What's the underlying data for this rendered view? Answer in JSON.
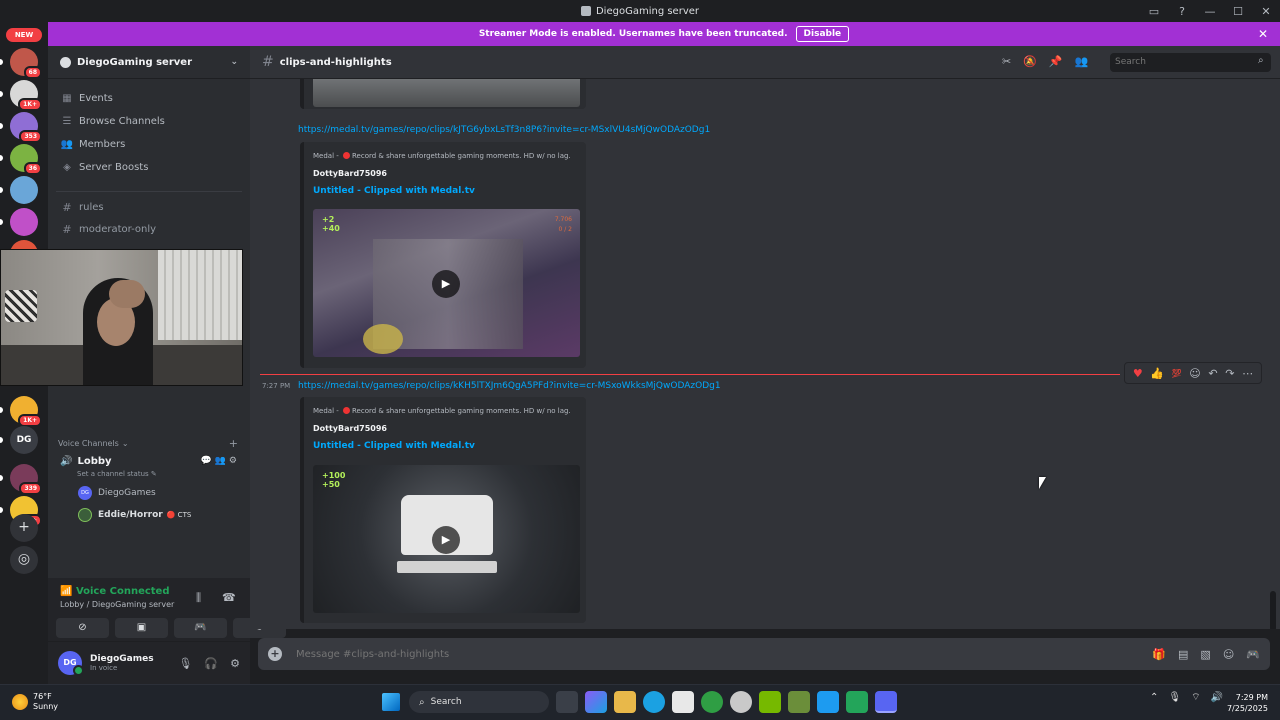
{
  "window": {
    "title": "DiegoGaming server",
    "controls": [
      "▭",
      "?",
      "—",
      "☐",
      "✕"
    ]
  },
  "guilds": {
    "new_label": "NEW",
    "items": [
      {
        "badge": "68",
        "color": "#c0574a"
      },
      {
        "badge": "1K+",
        "color": "#d8d8d8"
      },
      {
        "badge": "353",
        "color": "#8f6ed5"
      },
      {
        "badge": "36",
        "color": "#7cb342"
      },
      {
        "badge": "",
        "color": "#6aa6d8"
      },
      {
        "badge": "",
        "color": "#c050c8"
      },
      {
        "badge": "",
        "color": "#e0543b"
      },
      {
        "badge": "1K+",
        "color": "#f0b030"
      },
      {
        "badge": "",
        "color": "#3a3d44",
        "initials": "DG"
      },
      {
        "badge": "339",
        "color": "#7a3b5a"
      },
      {
        "badge": "2K+",
        "color": "#f1c232"
      }
    ],
    "add_icon": "+",
    "discover_icon": "◎"
  },
  "banner": {
    "text": "Streamer Mode is enabled. Usernames have been truncated.",
    "button": "Disable",
    "close": "✕"
  },
  "server": {
    "name": "DiegoGaming server",
    "chevron": "⌄",
    "nav": [
      {
        "label": "Events",
        "icon": "▦"
      },
      {
        "label": "Browse Channels",
        "icon": "☰"
      },
      {
        "label": "Members",
        "icon": "👥"
      },
      {
        "label": "Server Boosts",
        "icon": "◈"
      }
    ],
    "channels": [
      {
        "label": "rules"
      },
      {
        "label": "moderator-only"
      }
    ],
    "voice_header": "Voice Channels",
    "voice_channel": "Lobby",
    "voice_status": "Set a channel status ✎",
    "voice_users": [
      {
        "name": "DiegoGames",
        "initials": "DG",
        "color": "#5865f2",
        "tag": ""
      },
      {
        "name": "Eddie/Horror",
        "initials": "",
        "color": "#3b5e3a",
        "tag": "🔴 CTS"
      }
    ]
  },
  "voice_panel": {
    "status": "Voice Connected",
    "location": "Lobby / DiegoGaming server"
  },
  "user": {
    "initials": "DG",
    "name": "DiegoGames",
    "status": "In voice"
  },
  "channel": {
    "name": "clips-and-highlights",
    "search_placeholder": "Search"
  },
  "messages": [
    {
      "time": "",
      "link": "https://medal.tv/games/repo/clips/kJTG6ybxLsTf3n8P6?invite=cr-MSxlVU4sMjQwODAzODg1",
      "provider": "Medal - ",
      "provider_tail": "Record & share unforgettable gaming moments. HD w/ no lag.",
      "author": "DottyBard75096",
      "title": "Untitled - Clipped with Medal.tv",
      "hud": "+2\n+40",
      "hud2": "7.706\n0 / 2"
    },
    {
      "time": "7:27 PM",
      "link": "https://medal.tv/games/repo/clips/kKH5lTXJm6QgA5PFd?invite=cr-MSxoWkksMjQwODAzODg1",
      "provider": "Medal - ",
      "provider_tail": "Record & share unforgettable gaming moments. HD w/ no lag.",
      "author": "DottyBard75096",
      "title": "Untitled - Clipped with Medal.tv",
      "hud": "+100\n+50",
      "hud2": ""
    }
  ],
  "composer": {
    "placeholder": "Message #clips-and-highlights"
  },
  "taskbar": {
    "temp": "76°F",
    "condition": "Sunny",
    "search": "Search",
    "time": "7:29 PM",
    "date": "7/25/2025",
    "apps": [
      {
        "name": "files",
        "color": "#e8b84a"
      },
      {
        "name": "edge",
        "color": "#1ba1e2"
      },
      {
        "name": "store",
        "color": "#e8e8e8"
      },
      {
        "name": "xbox",
        "color": "#2f9e44"
      },
      {
        "name": "chrome",
        "color": "#c9c9c9"
      },
      {
        "name": "nvidia",
        "color": "#76b900"
      },
      {
        "name": "minecraft",
        "color": "#6b8e3a"
      },
      {
        "name": "twitter",
        "color": "#1d9bf0"
      },
      {
        "name": "discord-green",
        "color": "#23a55a"
      },
      {
        "name": "discord",
        "color": "#5865f2"
      }
    ]
  },
  "colors": {
    "accent": "#5865f2",
    "banner": "#a230d4",
    "link": "#00a8fc",
    "online": "#23a55a",
    "new_divider": "#f23f43"
  }
}
